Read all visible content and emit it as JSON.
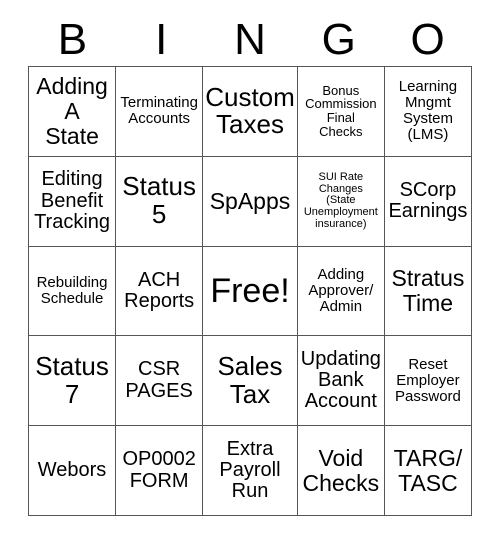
{
  "card": {
    "header_letters": [
      "B",
      "I",
      "N",
      "G",
      "O"
    ],
    "free_space_label": "Free!",
    "colors": {
      "background": "#ffffff",
      "text": "#000000",
      "grid_line": "#555555"
    },
    "rows": [
      [
        {
          "label": "Adding\nA\nState",
          "size": "lg"
        },
        {
          "label": "Terminating\nAccounts",
          "size": "sm"
        },
        {
          "label": "Custom\nTaxes",
          "size": "xl"
        },
        {
          "label": "Bonus\nCommission\nFinal\nChecks",
          "size": "xs"
        },
        {
          "label": "Learning\nMngmt\nSystem\n(LMS)",
          "size": "sm"
        }
      ],
      [
        {
          "label": "Editing\nBenefit\nTracking",
          "size": "md"
        },
        {
          "label": "Status\n5",
          "size": "xl"
        },
        {
          "label": "SpApps",
          "size": "lg"
        },
        {
          "label": "SUI Rate\nChanges\n(State\nUnemployment\ninsurance)",
          "size": "xxs"
        },
        {
          "label": "SCorp\nEarnings",
          "size": "md"
        }
      ],
      [
        {
          "label": "Rebuilding\nSchedule",
          "size": "sm"
        },
        {
          "label": "ACH\nReports",
          "size": "md"
        },
        {
          "label": "Free!",
          "size": "xxl"
        },
        {
          "label": "Adding\nApprover/\nAdmin",
          "size": "sm"
        },
        {
          "label": "Stratus\nTime",
          "size": "lg"
        }
      ],
      [
        {
          "label": "Status\n7",
          "size": "xl"
        },
        {
          "label": "CSR\nPAGES",
          "size": "md"
        },
        {
          "label": "Sales\nTax",
          "size": "xl"
        },
        {
          "label": "Updating\nBank\nAccount",
          "size": "md"
        },
        {
          "label": "Reset\nEmployer\nPassword",
          "size": "sm"
        }
      ],
      [
        {
          "label": "Webors",
          "size": "md"
        },
        {
          "label": "OP0002\nFORM",
          "size": "md"
        },
        {
          "label": "Extra\nPayroll\nRun",
          "size": "md"
        },
        {
          "label": "Void\nChecks",
          "size": "lg"
        },
        {
          "label": "TARG/\nTASC",
          "size": "lg"
        }
      ]
    ]
  }
}
